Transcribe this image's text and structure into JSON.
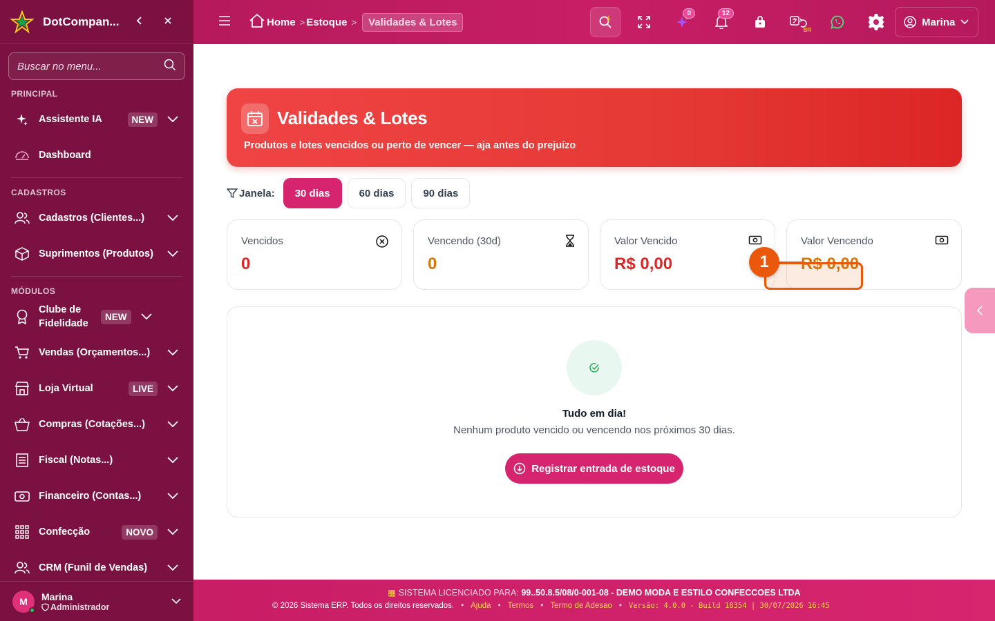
{
  "brand": {
    "name": "DotCompan..."
  },
  "sidebar": {
    "search_placeholder": "Buscar no menu...",
    "sections": [
      "PRINCIPAL",
      "CADASTROS",
      "MÓDULOS"
    ],
    "items": [
      {
        "label": "Assistente IA",
        "badge": "NEW"
      },
      {
        "label": "Dashboard"
      },
      {
        "label": "Cadastros (Clientes...)"
      },
      {
        "label": "Suprimentos (Produtos)"
      },
      {
        "label": "Clube de Fidelidade",
        "badge": "NEW"
      },
      {
        "label": "Vendas (Orçamentos...)"
      },
      {
        "label": "Loja Virtual",
        "badge": "LIVE"
      },
      {
        "label": "Compras (Cotações...)"
      },
      {
        "label": "Fiscal (Notas...)"
      },
      {
        "label": "Financeiro (Contas...)"
      },
      {
        "label": "Confecção",
        "badge": "NOVO"
      },
      {
        "label": "CRM (Funil de Vendas)"
      }
    ],
    "user": {
      "initial": "M",
      "name": "Marina",
      "role": "Administrador"
    }
  },
  "header": {
    "breadcrumb": [
      "Home",
      "Estoque",
      "Validades & Lotes"
    ],
    "ai_count": "0",
    "notif_count": "12",
    "lang_badge": "BR",
    "user_name": "Marina"
  },
  "hero": {
    "title": "Validades & Lotes",
    "subtitle": "Produtos e lotes vencidos ou perto de vencer — aja antes do prejuízo"
  },
  "filters": {
    "label": "Janela:",
    "options": [
      "30 dias",
      "60 dias",
      "90 dias"
    ],
    "selected": "30 dias"
  },
  "cards": [
    {
      "title": "Vencidos",
      "value": "0",
      "color": "#dc2626"
    },
    {
      "title": "Vencendo (30d)",
      "value": "0",
      "color": "#d97706"
    },
    {
      "title": "Valor Vencido",
      "value": "R$ 0,00",
      "color": "#dc2626"
    },
    {
      "title": "Valor Vencendo",
      "value": "R$ 0,00",
      "color": "#d97706"
    }
  ],
  "empty": {
    "title": "Tudo em dia!",
    "subtitle": "Nenhum produto vencido ou vencendo nos próximos 30 dias.",
    "cta": "Registrar entrada de estoque"
  },
  "annotation": {
    "number": "1"
  },
  "footer": {
    "license_key": "SISTEMA LICENCIADO PARA:",
    "license_value": "99..50.8.5/08/0-001-08 - DEMO MODA E ESTILO CONFECCOES LTDA",
    "copyright": "© 2026 Sistema ERP. Todos os direitos reservados.",
    "links": [
      "Ajuda",
      "Termos",
      "Termo de Adesao"
    ],
    "version": "Versão: 4.0.0 - Build 18354 | 30/07/2026 16:45"
  },
  "colors": {
    "primary": "#d6246e",
    "sidebar": "#7a1140",
    "danger": "#dc2626",
    "warning": "#d97706",
    "annotation": "#ea580c"
  }
}
